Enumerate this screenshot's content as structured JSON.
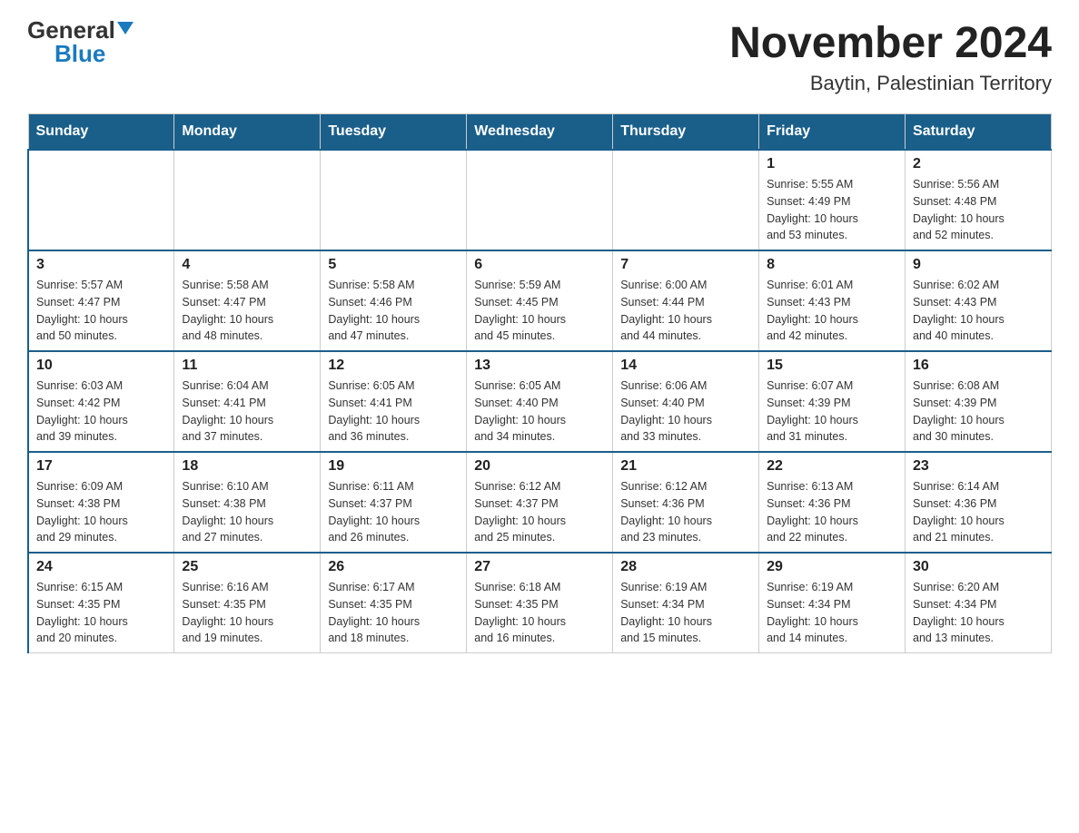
{
  "header": {
    "logo_general": "General",
    "logo_blue": "Blue",
    "month_year": "November 2024",
    "location": "Baytin, Palestinian Territory"
  },
  "days_of_week": [
    "Sunday",
    "Monday",
    "Tuesday",
    "Wednesday",
    "Thursday",
    "Friday",
    "Saturday"
  ],
  "weeks": [
    [
      {
        "day": "",
        "info": ""
      },
      {
        "day": "",
        "info": ""
      },
      {
        "day": "",
        "info": ""
      },
      {
        "day": "",
        "info": ""
      },
      {
        "day": "",
        "info": ""
      },
      {
        "day": "1",
        "info": "Sunrise: 5:55 AM\nSunset: 4:49 PM\nDaylight: 10 hours\nand 53 minutes."
      },
      {
        "day": "2",
        "info": "Sunrise: 5:56 AM\nSunset: 4:48 PM\nDaylight: 10 hours\nand 52 minutes."
      }
    ],
    [
      {
        "day": "3",
        "info": "Sunrise: 5:57 AM\nSunset: 4:47 PM\nDaylight: 10 hours\nand 50 minutes."
      },
      {
        "day": "4",
        "info": "Sunrise: 5:58 AM\nSunset: 4:47 PM\nDaylight: 10 hours\nand 48 minutes."
      },
      {
        "day": "5",
        "info": "Sunrise: 5:58 AM\nSunset: 4:46 PM\nDaylight: 10 hours\nand 47 minutes."
      },
      {
        "day": "6",
        "info": "Sunrise: 5:59 AM\nSunset: 4:45 PM\nDaylight: 10 hours\nand 45 minutes."
      },
      {
        "day": "7",
        "info": "Sunrise: 6:00 AM\nSunset: 4:44 PM\nDaylight: 10 hours\nand 44 minutes."
      },
      {
        "day": "8",
        "info": "Sunrise: 6:01 AM\nSunset: 4:43 PM\nDaylight: 10 hours\nand 42 minutes."
      },
      {
        "day": "9",
        "info": "Sunrise: 6:02 AM\nSunset: 4:43 PM\nDaylight: 10 hours\nand 40 minutes."
      }
    ],
    [
      {
        "day": "10",
        "info": "Sunrise: 6:03 AM\nSunset: 4:42 PM\nDaylight: 10 hours\nand 39 minutes."
      },
      {
        "day": "11",
        "info": "Sunrise: 6:04 AM\nSunset: 4:41 PM\nDaylight: 10 hours\nand 37 minutes."
      },
      {
        "day": "12",
        "info": "Sunrise: 6:05 AM\nSunset: 4:41 PM\nDaylight: 10 hours\nand 36 minutes."
      },
      {
        "day": "13",
        "info": "Sunrise: 6:05 AM\nSunset: 4:40 PM\nDaylight: 10 hours\nand 34 minutes."
      },
      {
        "day": "14",
        "info": "Sunrise: 6:06 AM\nSunset: 4:40 PM\nDaylight: 10 hours\nand 33 minutes."
      },
      {
        "day": "15",
        "info": "Sunrise: 6:07 AM\nSunset: 4:39 PM\nDaylight: 10 hours\nand 31 minutes."
      },
      {
        "day": "16",
        "info": "Sunrise: 6:08 AM\nSunset: 4:39 PM\nDaylight: 10 hours\nand 30 minutes."
      }
    ],
    [
      {
        "day": "17",
        "info": "Sunrise: 6:09 AM\nSunset: 4:38 PM\nDaylight: 10 hours\nand 29 minutes."
      },
      {
        "day": "18",
        "info": "Sunrise: 6:10 AM\nSunset: 4:38 PM\nDaylight: 10 hours\nand 27 minutes."
      },
      {
        "day": "19",
        "info": "Sunrise: 6:11 AM\nSunset: 4:37 PM\nDaylight: 10 hours\nand 26 minutes."
      },
      {
        "day": "20",
        "info": "Sunrise: 6:12 AM\nSunset: 4:37 PM\nDaylight: 10 hours\nand 25 minutes."
      },
      {
        "day": "21",
        "info": "Sunrise: 6:12 AM\nSunset: 4:36 PM\nDaylight: 10 hours\nand 23 minutes."
      },
      {
        "day": "22",
        "info": "Sunrise: 6:13 AM\nSunset: 4:36 PM\nDaylight: 10 hours\nand 22 minutes."
      },
      {
        "day": "23",
        "info": "Sunrise: 6:14 AM\nSunset: 4:36 PM\nDaylight: 10 hours\nand 21 minutes."
      }
    ],
    [
      {
        "day": "24",
        "info": "Sunrise: 6:15 AM\nSunset: 4:35 PM\nDaylight: 10 hours\nand 20 minutes."
      },
      {
        "day": "25",
        "info": "Sunrise: 6:16 AM\nSunset: 4:35 PM\nDaylight: 10 hours\nand 19 minutes."
      },
      {
        "day": "26",
        "info": "Sunrise: 6:17 AM\nSunset: 4:35 PM\nDaylight: 10 hours\nand 18 minutes."
      },
      {
        "day": "27",
        "info": "Sunrise: 6:18 AM\nSunset: 4:35 PM\nDaylight: 10 hours\nand 16 minutes."
      },
      {
        "day": "28",
        "info": "Sunrise: 6:19 AM\nSunset: 4:34 PM\nDaylight: 10 hours\nand 15 minutes."
      },
      {
        "day": "29",
        "info": "Sunrise: 6:19 AM\nSunset: 4:34 PM\nDaylight: 10 hours\nand 14 minutes."
      },
      {
        "day": "30",
        "info": "Sunrise: 6:20 AM\nSunset: 4:34 PM\nDaylight: 10 hours\nand 13 minutes."
      }
    ]
  ]
}
